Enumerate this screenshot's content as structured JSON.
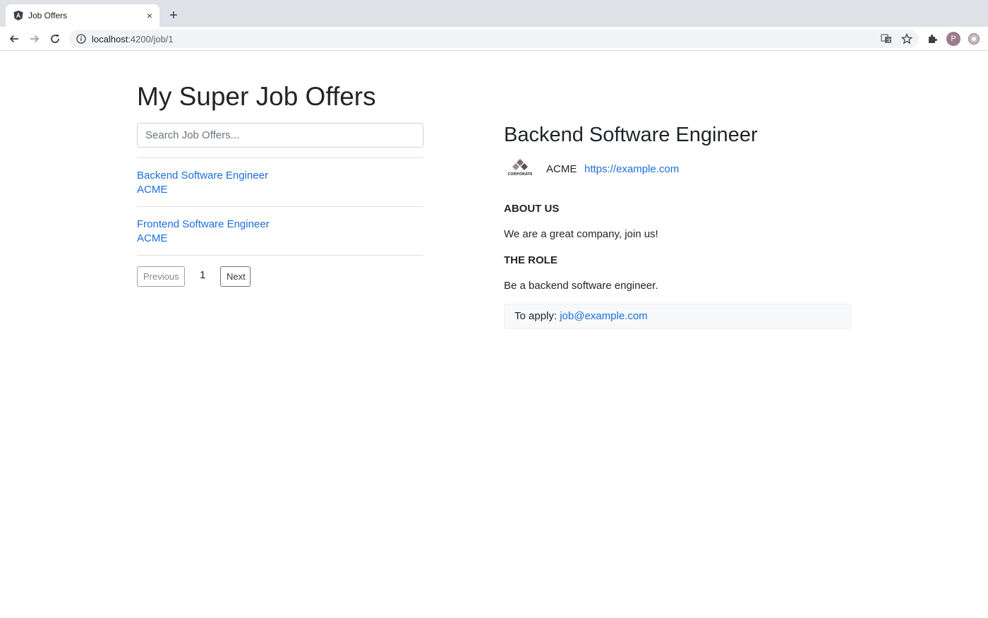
{
  "browser": {
    "tab_title": "Job Offers",
    "close_glyph": "×",
    "new_tab_glyph": "+",
    "url_host": "localhost",
    "url_path": ":4200/job/1",
    "profile_initial": "P"
  },
  "page": {
    "title": "My Super Job Offers",
    "search_placeholder": "Search Job Offers..."
  },
  "job_list": [
    {
      "title": "Backend Software Engineer",
      "company": "ACME"
    },
    {
      "title": "Frontend Software Engineer",
      "company": "ACME"
    }
  ],
  "pagination": {
    "previous_label": "Previous",
    "current_page": "1",
    "next_label": "Next"
  },
  "detail": {
    "title": "Backend Software Engineer",
    "logo_text": "CORPORATE",
    "company": "ACME",
    "website": "https://example.com",
    "about_heading": "ABOUT US",
    "about_text": "We are a great company, join us!",
    "role_heading": "THE ROLE",
    "role_text": "Be a backend software engineer.",
    "apply_prefix": "To apply:",
    "apply_email": "job@example.com"
  },
  "colors": {
    "link": "#1a6fd8",
    "text": "#212529",
    "border": "#dee2e6",
    "chrome_bg": "#dee1e6"
  }
}
